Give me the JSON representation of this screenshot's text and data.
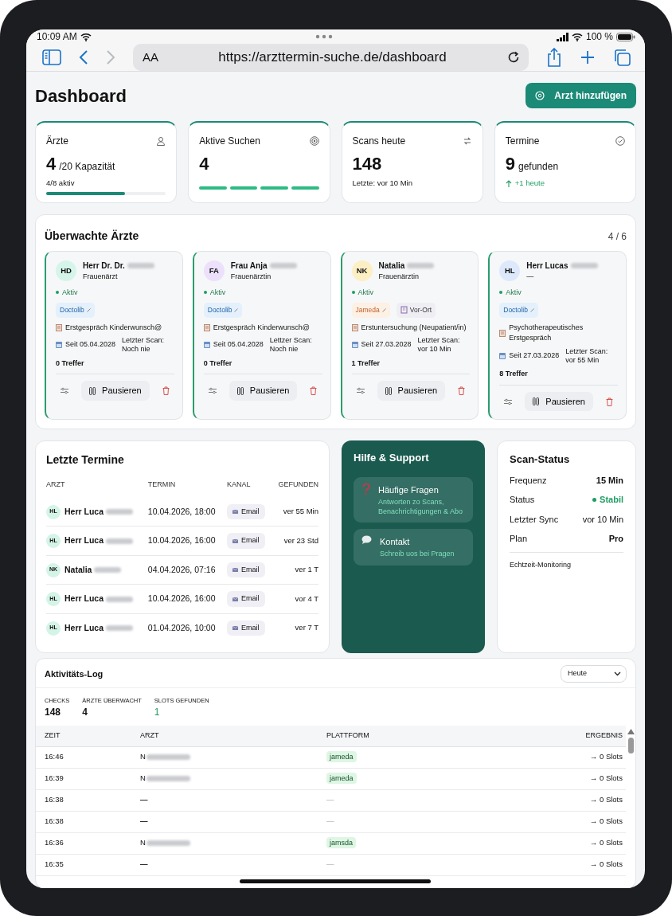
{
  "status_bar": {
    "time": "10:09 AM",
    "battery": "100 %"
  },
  "browser": {
    "text_size": "AA",
    "url": "https://arzttermin-suche.de/dashboard"
  },
  "page_title": "Dashboard",
  "add_button": "Arzt hinzufügen",
  "stats": [
    {
      "kind": "progress",
      "label": "Ärzte",
      "value": "4",
      "suffix": "/20 Kapazität",
      "note": "4/8 aktiv",
      "level": 0.66
    },
    {
      "kind": "segments",
      "label": "Aktive Suchen",
      "value": "4",
      "segments": [
        {
          "on": true
        },
        {
          "on": true
        },
        {
          "on": true
        },
        {
          "on": true
        }
      ]
    },
    {
      "kind": "text",
      "label": "Scans heute",
      "value": "148",
      "note": "Letzte: vor 10 Min"
    },
    {
      "kind": "trend",
      "label": "Termine",
      "value": "9",
      "suffix": "gefunden",
      "note": "+1 heute"
    }
  ],
  "doctors_panel": {
    "title": "Überwachte Ärzte",
    "count": "4 / 6",
    "doctors": [
      {
        "initials": "HD",
        "color": "#d6f5ea",
        "name": "Herr Dr. Dr.",
        "specialty": "Frauenärzt",
        "status": "Aktiv",
        "active": true,
        "tags": [
          {
            "kind": "platform",
            "label": "Doctolib",
            "color": "#e4f0fb"
          }
        ],
        "appointment": "Erstgespräch Kinderwunsch@",
        "since": "Seit 05.04.2028",
        "last_scan_label": "Letzter Scan:",
        "last_scan": "Noch nie",
        "hits": "0 Treffer",
        "pause": "Pausieren"
      },
      {
        "initials": "FA",
        "color": "#ece0fb",
        "name": "Frau Anja",
        "specialty": "Frauenärztin",
        "status": "Aktiv",
        "active": true,
        "tags": [
          {
            "kind": "platform",
            "label": "Doctolib",
            "color": "#e4f0fb"
          }
        ],
        "appointment": "Erstgespräch Kinderwunsch@",
        "since": "Seit 05.04.2028",
        "last_scan_label": "Lettzer Scan:",
        "last_scan": "Noch nie",
        "hits": "0 Treffer",
        "pause": "Pausieren"
      },
      {
        "initials": "NK",
        "color": "#fcefc4",
        "name": "Natalia",
        "specialty": "Frauenärztin",
        "status": "Aktiv",
        "active": true,
        "tags": [
          {
            "kind": "platform",
            "label": "Jameda",
            "color": "#fdf0e4"
          },
          {
            "kind": "location",
            "label": "Vor-Ort",
            "color": "#eeeef3"
          }
        ],
        "appointment": "Erstuntersuchung (Neupatient/in)",
        "since": "Seit 27.03.2028",
        "last_scan_label": "Letzter Scan:",
        "last_scan": "vor 10 Min",
        "hits": "1 Treffer",
        "pause": "Pausieren"
      },
      {
        "initials": "HL",
        "color": "#dde9fb",
        "name": "Herr Lucas",
        "specialty": "—",
        "status": "Aktiv",
        "active": true,
        "tags": [
          {
            "kind": "platform",
            "label": "Doctolib",
            "color": "#e4f0fb"
          }
        ],
        "appointment": "Psychotherapeutisches Erstgespräch",
        "since": "Seit 27.03.2028",
        "last_scan_label": "Letzter Scan:",
        "last_scan": "vor 55 Min",
        "hits": "8 Treffer",
        "pause": "Pausieren"
      }
    ]
  },
  "recent": {
    "title": "Letzte Termine",
    "columns": [
      "ARZT",
      "TERMIN",
      "KANAL",
      "GEFUNDEN"
    ],
    "rows": [
      {
        "initials": "HL",
        "name": "Herr Luca",
        "termin": "10.04.2026, 18:00",
        "channel": "Email",
        "found": "ver 55 Min"
      },
      {
        "initials": "HL",
        "name": "Herr Luca",
        "termin": "10.04.2026, 16:00",
        "channel": "Email",
        "found": "ver 23 Std"
      },
      {
        "initials": "NK",
        "name": "Natalia",
        "termin": "04.04.2026, 07:16",
        "channel": "Email",
        "found": "ver 1 T"
      },
      {
        "initials": "HL",
        "name": "Herr Luca",
        "termin": "10.04.2026, 16:00",
        "channel": "Email",
        "found": "vor 4 T"
      },
      {
        "initials": "HL",
        "name": "Herr Luca",
        "termin": "01.04.2026, 10:00",
        "channel": "Email",
        "found": "ver 7 T"
      }
    ]
  },
  "help": {
    "title": "Hilfe & Support",
    "items": [
      {
        "kind": "faq",
        "title": "Häufige Fragen",
        "subtitle": "Antworten zo Scans, Benachrichtigungen & Abo"
      },
      {
        "kind": "contact",
        "title": "Kontakt",
        "subtitle": "Schreib uos bei Pragen"
      }
    ]
  },
  "scan_status": {
    "title": "Scan-Status",
    "rows": [
      {
        "kind": "plain",
        "label": "Frequenz",
        "value": "15 Min"
      },
      {
        "kind": "status",
        "label": "Status",
        "value": "Stabil"
      },
      {
        "kind": "muted",
        "label": "Letzter Sync",
        "value": "vor 10 Min"
      },
      {
        "kind": "plain",
        "label": "Plan",
        "value": "Pro"
      }
    ],
    "footer": "Echtzeit-Monitoring"
  },
  "activity": {
    "title": "Aktivitäts-Log",
    "filter": "Heute",
    "stats": [
      {
        "label": "CHECKS",
        "value": "148",
        "highlight": false
      },
      {
        "label": "ÄRZTE ÜBERWACHT",
        "value": "4",
        "highlight": false
      },
      {
        "label": "SLOTS GEFUNDEN",
        "value": "1",
        "highlight": true
      }
    ],
    "columns": [
      "ZEIT",
      "ARZT",
      "PLATTFORM",
      "ERGEBNIS"
    ],
    "rows": [
      {
        "time": "16:46",
        "doctor": {
          "kind": "redacted",
          "label": "N"
        },
        "platform": {
          "kind": "tag",
          "label": "jameda"
        },
        "result": "→ 0 Slots"
      },
      {
        "time": "16:39",
        "doctor": {
          "kind": "redacted",
          "label": "N"
        },
        "platform": {
          "kind": "tag",
          "label": "jameda"
        },
        "result": "→ 0 Slots"
      },
      {
        "time": "16:38",
        "doctor": {
          "kind": "none",
          "label": "—"
        },
        "platform": {
          "kind": "none",
          "label": "—"
        },
        "result": "→ 0 Slots"
      },
      {
        "time": "16:38",
        "doctor": {
          "kind": "none",
          "label": "—"
        },
        "platform": {
          "kind": "none",
          "label": "—"
        },
        "result": "→ 0 Slots"
      },
      {
        "time": "16:36",
        "doctor": {
          "kind": "redacted",
          "label": "N"
        },
        "platform": {
          "kind": "tag",
          "label": "jamsda"
        },
        "result": "→ 0 Slots"
      },
      {
        "time": "16:35",
        "doctor": {
          "kind": "none",
          "label": "—"
        },
        "platform": {
          "kind": "none",
          "label": "—"
        },
        "result": "→ 0 Slots"
      }
    ]
  }
}
